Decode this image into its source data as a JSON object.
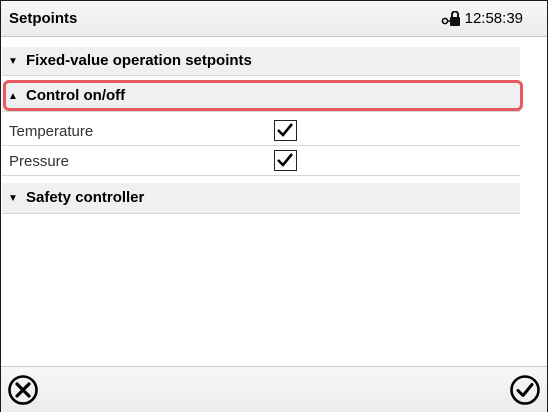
{
  "header": {
    "title": "Setpoints",
    "time": "12:58:39",
    "lock_icon": "lock-key-icon"
  },
  "sections": {
    "fixed_value": {
      "label": "Fixed-value operation setpoints",
      "icon": "triangle-down",
      "expanded": false
    },
    "control_onoff": {
      "label": "Control on/off",
      "icon": "triangle-up",
      "expanded": true,
      "highlighted": true
    },
    "safety": {
      "label": "Safety controller",
      "icon": "triangle-down",
      "expanded": false
    }
  },
  "rows": [
    {
      "label": "Temperature",
      "checked": true
    },
    {
      "label": "Pressure",
      "checked": true
    }
  ],
  "footer": {
    "cancel_icon": "circle-x-icon",
    "confirm_icon": "circle-check-icon"
  },
  "colors": {
    "highlight": "#e35b5f",
    "section_bg": "#f0f0f0"
  }
}
